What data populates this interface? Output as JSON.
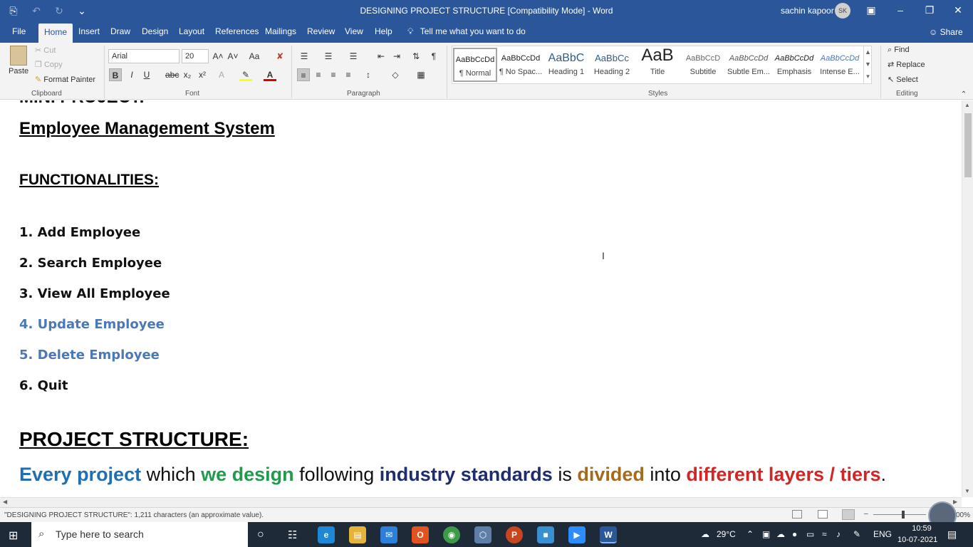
{
  "window": {
    "title": "DESIGNING PROJECT STRUCTURE [Compatibility Mode]  -  Word",
    "user_name": "sachin kapoor",
    "user_initials": "SK"
  },
  "tabs": {
    "items": [
      "File",
      "Home",
      "Insert",
      "Draw",
      "Design",
      "Layout",
      "References",
      "Mailings",
      "Review",
      "View",
      "Help"
    ],
    "tell_me": "Tell me what you want to do",
    "share": "Share"
  },
  "ribbon": {
    "clipboard": {
      "paste": "Paste",
      "cut": "Cut",
      "copy": "Copy",
      "format_painter": "Format Painter",
      "label": "Clipboard"
    },
    "font": {
      "name": "Arial",
      "size": "20",
      "label": "Font"
    },
    "paragraph": {
      "label": "Paragraph"
    },
    "styles": {
      "label": "Styles",
      "items": [
        {
          "sample": "AaBbCcDd",
          "name": "¶ Normal"
        },
        {
          "sample": "AaBbCcDd",
          "name": "¶ No Spac..."
        },
        {
          "sample": "AaBbC",
          "name": "Heading 1"
        },
        {
          "sample": "AaBbCc",
          "name": "Heading 2"
        },
        {
          "sample": "AaB",
          "name": "Title"
        },
        {
          "sample": "AaBbCcD",
          "name": "Subtitle"
        },
        {
          "sample": "AaBbCcDd",
          "name": "Subtle Em..."
        },
        {
          "sample": "AaBbCcDd",
          "name": "Emphasis"
        },
        {
          "sample": "AaBbCcDd",
          "name": "Intense E..."
        }
      ]
    },
    "editing": {
      "find": "Find",
      "replace": "Replace",
      "select": "Select",
      "label": "Editing"
    }
  },
  "document": {
    "cut_heading": "MINI PROJECT:",
    "title": "Employee Management System",
    "functionalities_heading": "FUNCTIONALITIES:",
    "items": [
      "1. Add Employee",
      "2. Search Employee",
      "3. View All Employee",
      "4. Update Employee",
      "5. Delete Employee",
      "6. Quit"
    ],
    "structure_heading": "PROJECT STRUCTURE:",
    "sentence": {
      "p1": "Every project",
      "p2": " which ",
      "p3": "we design",
      "p4": " following ",
      "p5": "industry standards",
      "p6": " is ",
      "p7": "divided",
      "p8": " into ",
      "p9": "different layers / tiers",
      "p10": "."
    }
  },
  "status": {
    "text": "\"DESIGNING PROJECT STRUCTURE\": 1,211 characters (an approximate value).",
    "zoom": "00%"
  },
  "taskbar": {
    "search_placeholder": "Type here to search",
    "temperature": "29°C",
    "language": "ENG",
    "time": "10:59",
    "date": "10-07-2021"
  },
  "colors": {
    "word_blue": "#2b579a",
    "item_blue": "#4a78b8",
    "sentence_blue": "#1f6fb5",
    "sentence_green": "#1e9b4b",
    "sentence_navy": "#1f2d6e",
    "sentence_brown": "#a56a1c",
    "sentence_red": "#d02626"
  }
}
